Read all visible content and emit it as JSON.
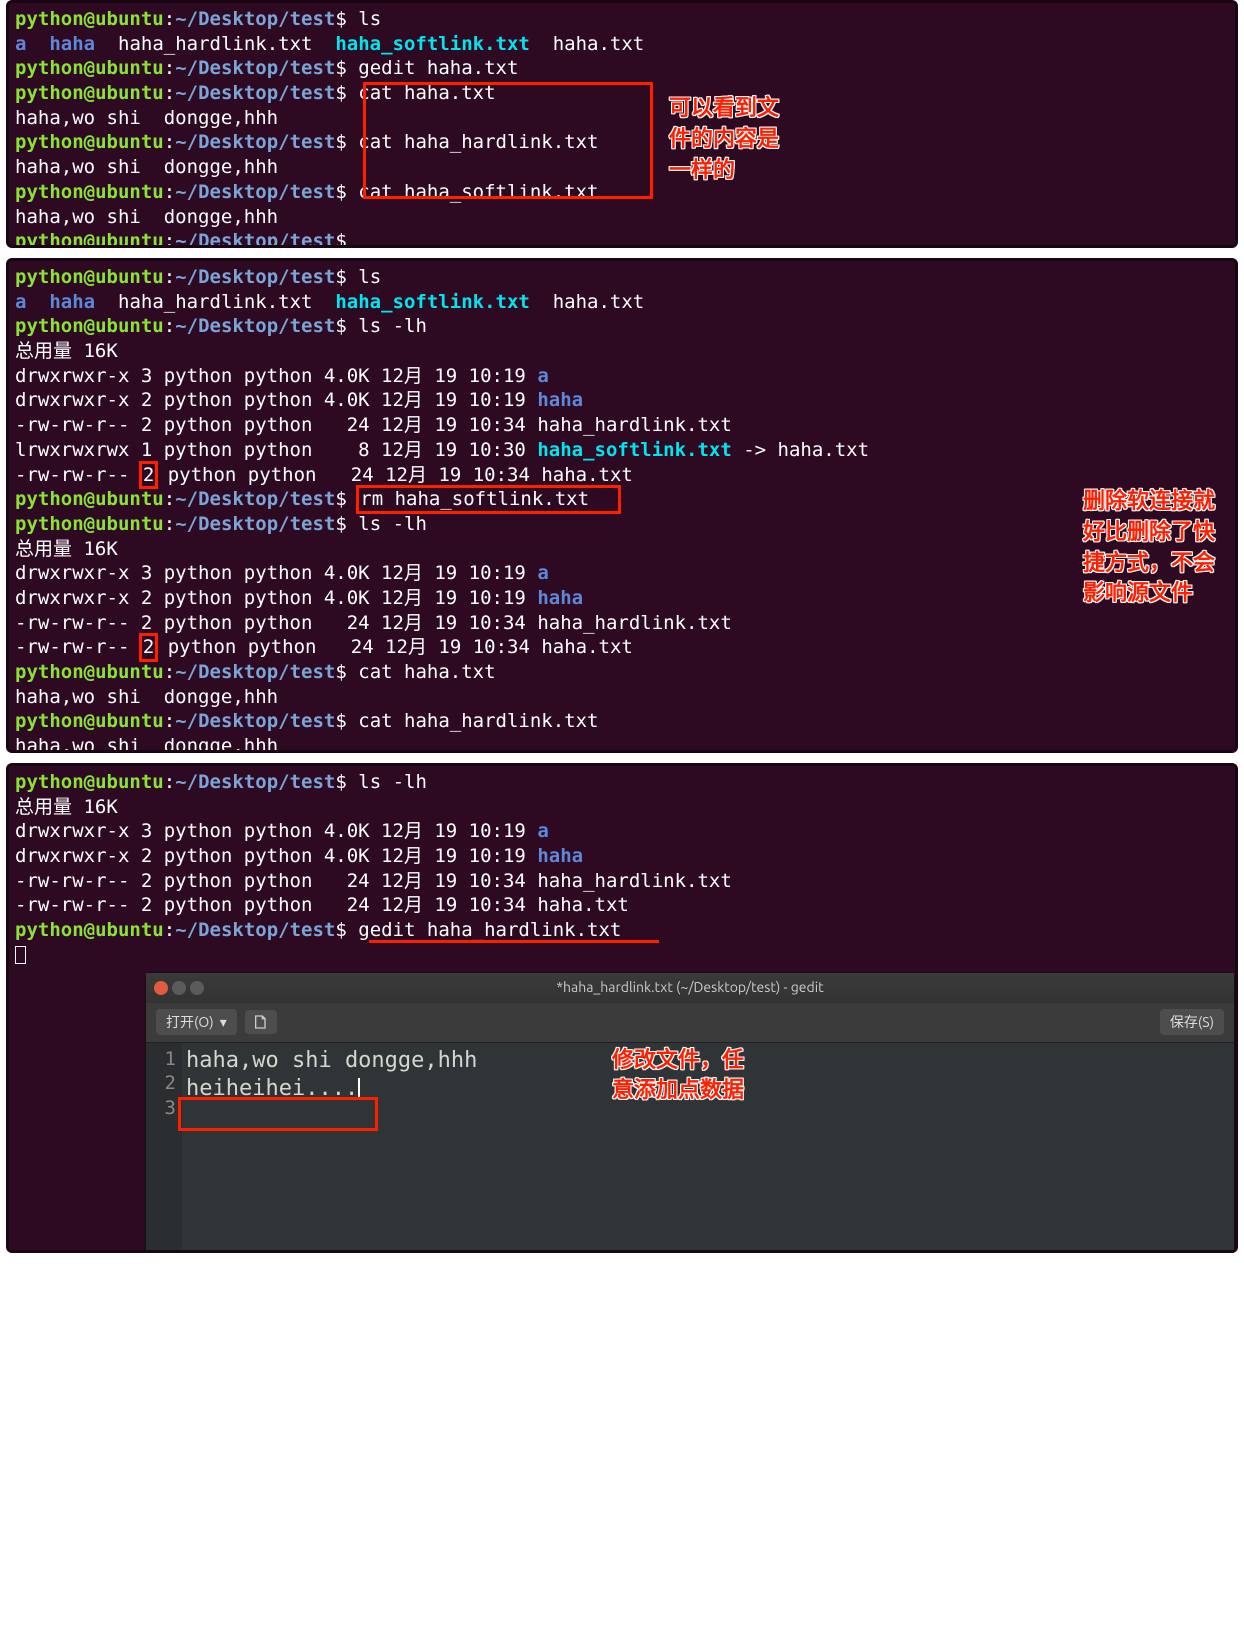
{
  "prompt": {
    "user": "python",
    "host": "ubuntu",
    "path": "~/Desktop/test",
    "sep": "$"
  },
  "files": {
    "a": "a",
    "haha": "haha",
    "hardlink": "haha_hardlink.txt",
    "softlink": "haha_softlink.txt",
    "txt": "haha.txt"
  },
  "cmds": {
    "ls": "ls",
    "gedit_haha": "gedit haha.txt",
    "cat_haha": "cat haha.txt",
    "cat_hard": "cat haha_hardlink.txt",
    "cat_soft": "cat haha_softlink.txt",
    "lslh": "ls -lh",
    "rm_soft": "rm haha_softlink.txt",
    "gedit_hard": "gedit haha_hardlink.txt"
  },
  "content": "haha,wo shi  dongge,hhh",
  "total": "总用量 16K",
  "ls1": {
    "r0": "drwxrwxr-x 3 python python 4.0K 12月 19 10:19 ",
    "r1": "drwxrwxr-x 2 python python 4.0K 12月 19 10:19 ",
    "r2": "-rw-rw-r-- 2 python python   24 12月 19 10:34 haha_hardlink.txt",
    "r3a": "lrwxrwxrwx 1 python python    8 12月 19 10:30 ",
    "r3b": " -> haha.txt",
    "r4a": "-rw-rw-r-- ",
    "r4n": "2",
    "r4b": " python python   24 12月 19 10:34 haha.txt"
  },
  "ls2": {
    "r0": "drwxrwxr-x 3 python python 4.0K 12月 19 10:19 ",
    "r1": "drwxrwxr-x 2 python python 4.0K 12月 19 10:19 ",
    "r2": "-rw-rw-r-- 2 python python   24 12月 19 10:34 haha_hardlink.txt",
    "r3a": "-rw-rw-r-- ",
    "r3n": "2",
    "r3b": " python python   24 12月 19 10:34 haha.txt"
  },
  "note1": "可以看到文\n件的内容是\n一样的",
  "note2": "删除软连接就\n好比删除了快\n捷方式，不会\n影响源文件",
  "note3": "修改文件，任\n意添加点数据",
  "gedit": {
    "title": "*haha_hardlink.txt (~/Desktop/test) - gedit",
    "open": "打开(O)",
    "save": "保存(S)",
    "line1": "haha,wo shi  dongge,hhh",
    "line2": "",
    "line3": "heiheihei....",
    "ln": [
      "1",
      "2",
      "3"
    ]
  }
}
